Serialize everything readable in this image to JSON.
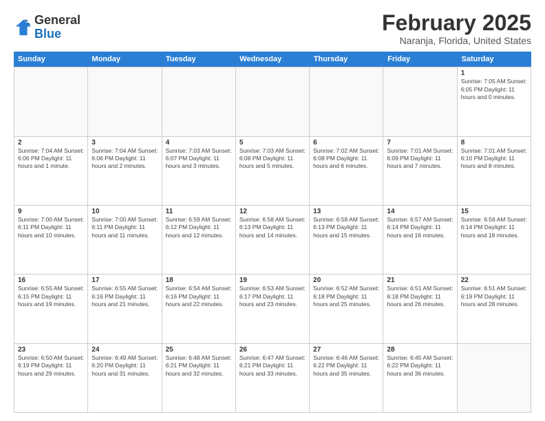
{
  "logo": {
    "general": "General",
    "blue": "Blue"
  },
  "title": "February 2025",
  "subtitle": "Naranja, Florida, United States",
  "headers": [
    "Sunday",
    "Monday",
    "Tuesday",
    "Wednesday",
    "Thursday",
    "Friday",
    "Saturday"
  ],
  "rows": [
    [
      {
        "day": "",
        "detail": "",
        "empty": true
      },
      {
        "day": "",
        "detail": "",
        "empty": true
      },
      {
        "day": "",
        "detail": "",
        "empty": true
      },
      {
        "day": "",
        "detail": "",
        "empty": true
      },
      {
        "day": "",
        "detail": "",
        "empty": true
      },
      {
        "day": "",
        "detail": "",
        "empty": true
      },
      {
        "day": "1",
        "detail": "Sunrise: 7:05 AM\nSunset: 6:05 PM\nDaylight: 11 hours\nand 0 minutes."
      }
    ],
    [
      {
        "day": "2",
        "detail": "Sunrise: 7:04 AM\nSunset: 6:06 PM\nDaylight: 11 hours\nand 1 minute."
      },
      {
        "day": "3",
        "detail": "Sunrise: 7:04 AM\nSunset: 6:06 PM\nDaylight: 11 hours\nand 2 minutes."
      },
      {
        "day": "4",
        "detail": "Sunrise: 7:03 AM\nSunset: 6:07 PM\nDaylight: 11 hours\nand 3 minutes."
      },
      {
        "day": "5",
        "detail": "Sunrise: 7:03 AM\nSunset: 6:08 PM\nDaylight: 11 hours\nand 5 minutes."
      },
      {
        "day": "6",
        "detail": "Sunrise: 7:02 AM\nSunset: 6:08 PM\nDaylight: 11 hours\nand 6 minutes."
      },
      {
        "day": "7",
        "detail": "Sunrise: 7:01 AM\nSunset: 6:09 PM\nDaylight: 11 hours\nand 7 minutes."
      },
      {
        "day": "8",
        "detail": "Sunrise: 7:01 AM\nSunset: 6:10 PM\nDaylight: 11 hours\nand 8 minutes."
      }
    ],
    [
      {
        "day": "9",
        "detail": "Sunrise: 7:00 AM\nSunset: 6:11 PM\nDaylight: 11 hours\nand 10 minutes."
      },
      {
        "day": "10",
        "detail": "Sunrise: 7:00 AM\nSunset: 6:11 PM\nDaylight: 11 hours\nand 11 minutes."
      },
      {
        "day": "11",
        "detail": "Sunrise: 6:59 AM\nSunset: 6:12 PM\nDaylight: 11 hours\nand 12 minutes."
      },
      {
        "day": "12",
        "detail": "Sunrise: 6:58 AM\nSunset: 6:13 PM\nDaylight: 11 hours\nand 14 minutes."
      },
      {
        "day": "13",
        "detail": "Sunrise: 6:58 AM\nSunset: 6:13 PM\nDaylight: 11 hours\nand 15 minutes."
      },
      {
        "day": "14",
        "detail": "Sunrise: 6:57 AM\nSunset: 6:14 PM\nDaylight: 11 hours\nand 16 minutes."
      },
      {
        "day": "15",
        "detail": "Sunrise: 6:56 AM\nSunset: 6:14 PM\nDaylight: 11 hours\nand 18 minutes."
      }
    ],
    [
      {
        "day": "16",
        "detail": "Sunrise: 6:55 AM\nSunset: 6:15 PM\nDaylight: 11 hours\nand 19 minutes."
      },
      {
        "day": "17",
        "detail": "Sunrise: 6:55 AM\nSunset: 6:16 PM\nDaylight: 11 hours\nand 21 minutes."
      },
      {
        "day": "18",
        "detail": "Sunrise: 6:54 AM\nSunset: 6:16 PM\nDaylight: 11 hours\nand 22 minutes."
      },
      {
        "day": "19",
        "detail": "Sunrise: 6:53 AM\nSunset: 6:17 PM\nDaylight: 11 hours\nand 23 minutes."
      },
      {
        "day": "20",
        "detail": "Sunrise: 6:52 AM\nSunset: 6:18 PM\nDaylight: 11 hours\nand 25 minutes."
      },
      {
        "day": "21",
        "detail": "Sunrise: 6:51 AM\nSunset: 6:18 PM\nDaylight: 11 hours\nand 26 minutes."
      },
      {
        "day": "22",
        "detail": "Sunrise: 6:51 AM\nSunset: 6:19 PM\nDaylight: 11 hours\nand 28 minutes."
      }
    ],
    [
      {
        "day": "23",
        "detail": "Sunrise: 6:50 AM\nSunset: 6:19 PM\nDaylight: 11 hours\nand 29 minutes."
      },
      {
        "day": "24",
        "detail": "Sunrise: 6:49 AM\nSunset: 6:20 PM\nDaylight: 11 hours\nand 31 minutes."
      },
      {
        "day": "25",
        "detail": "Sunrise: 6:48 AM\nSunset: 6:21 PM\nDaylight: 11 hours\nand 32 minutes."
      },
      {
        "day": "26",
        "detail": "Sunrise: 6:47 AM\nSunset: 6:21 PM\nDaylight: 11 hours\nand 33 minutes."
      },
      {
        "day": "27",
        "detail": "Sunrise: 6:46 AM\nSunset: 6:22 PM\nDaylight: 11 hours\nand 35 minutes."
      },
      {
        "day": "28",
        "detail": "Sunrise: 6:45 AM\nSunset: 6:22 PM\nDaylight: 11 hours\nand 36 minutes."
      },
      {
        "day": "",
        "detail": "",
        "empty": true
      }
    ]
  ]
}
